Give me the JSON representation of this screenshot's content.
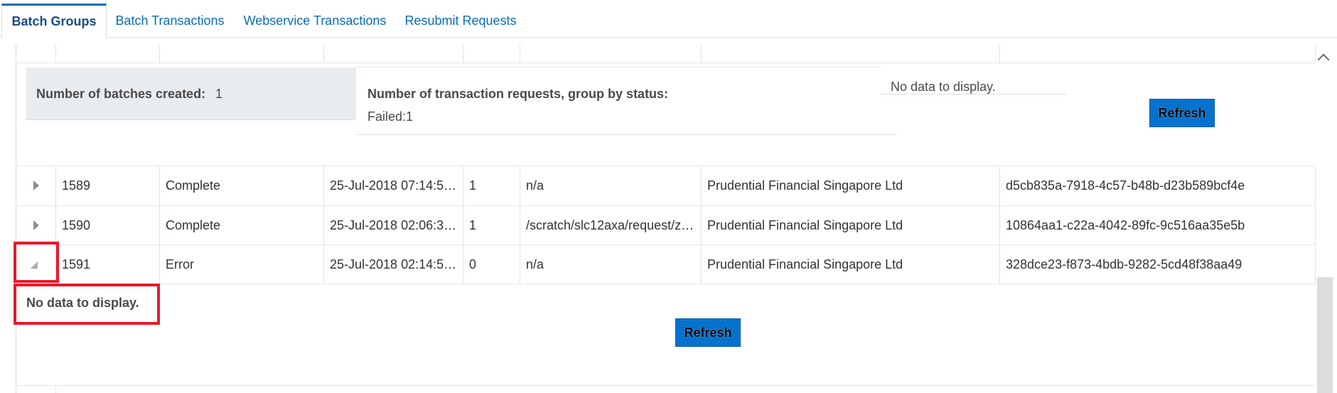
{
  "tabs": [
    {
      "label": "Batch Groups"
    },
    {
      "label": "Batch Transactions"
    },
    {
      "label": "Webservice Transactions"
    },
    {
      "label": "Resubmit Requests"
    }
  ],
  "summary": {
    "batches_label": "Number of batches created:",
    "batches_value": "1",
    "requests_heading": "Number of transaction requests, group by status:",
    "requests_status": "Failed:1",
    "no_data": "No data to display.",
    "refresh_label": "Refresh"
  },
  "rows": [
    {
      "id": "1589",
      "status": "Complete",
      "date": "25-Jul-2018 07:14:5…",
      "count": "1",
      "path": "n/a",
      "org": "Prudential Financial Singapore Ltd",
      "guid": "d5cb835a-7918-4c57-b48b-d23b589bcf4e"
    },
    {
      "id": "1590",
      "status": "Complete",
      "date": "25-Jul-2018 02:06:3…",
      "count": "1",
      "path": "/scratch/slc12axa/request/z…",
      "org": "Prudential Financial Singapore Ltd",
      "guid": "10864aa1-c22a-4042-89fc-9c516aa35e5b"
    },
    {
      "id": "1591",
      "status": "Error",
      "date": "25-Jul-2018 02:14:5…",
      "count": "0",
      "path": "n/a",
      "org": "Prudential Financial Singapore Ltd",
      "guid": "328dce23-f873-4bdb-9282-5cd48f38aa49"
    }
  ],
  "detail": {
    "no_data": "No data to display.",
    "refresh_label": "Refresh"
  },
  "colors": {
    "accent": "#0c6cb3",
    "button": "#0572ce",
    "highlight": "#e8192c"
  }
}
